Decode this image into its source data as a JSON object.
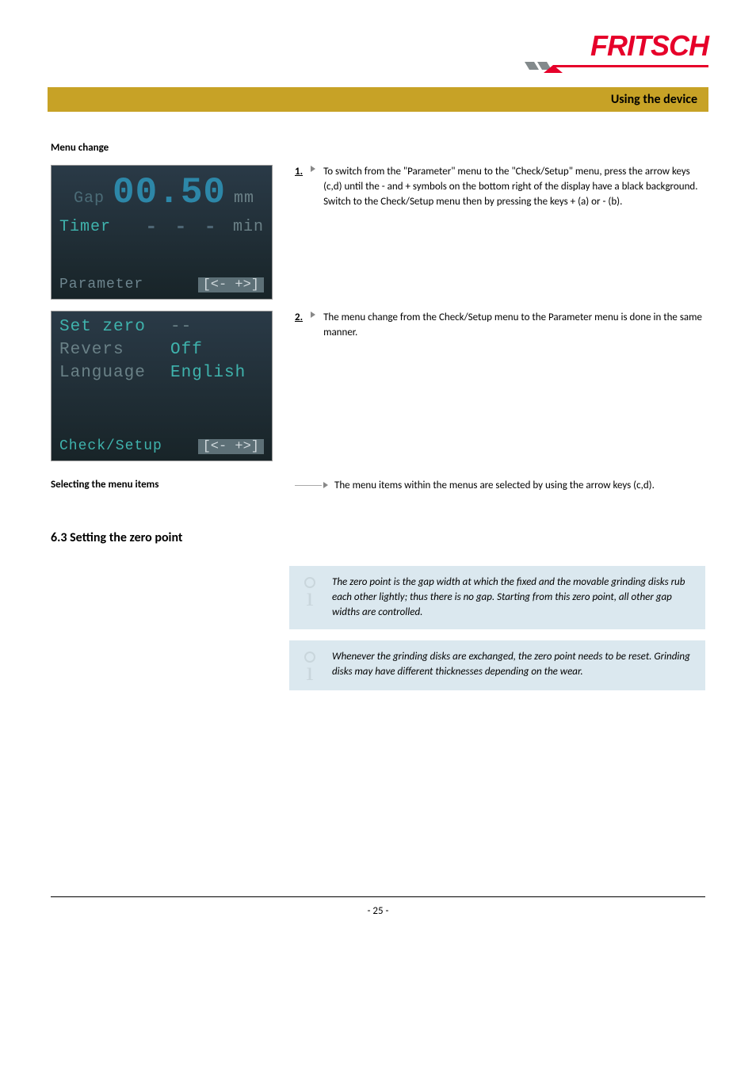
{
  "logo": {
    "text": "FRITSCH"
  },
  "title_bar": "Using the device",
  "menu_change_heading": "Menu change",
  "lcd1": {
    "gap_label": "Gap",
    "gap_value": "00.50",
    "gap_unit": "mm",
    "timer_label": "Timer",
    "timer_value": "- - -",
    "timer_unit": "min",
    "status_name": "Parameter",
    "status_arrows": "[<-  +>]"
  },
  "lcd2": {
    "setzero_label": "Set zero",
    "setzero_value": "--",
    "revers_label": "Revers",
    "revers_value": "Off",
    "language_label": "Language",
    "language_value": "English",
    "status_name": "Check/Setup",
    "status_arrows": "[<-  +>]"
  },
  "step1": {
    "num": "1.",
    "text": "To switch from the \"Parameter\" menu to the \"Check/Setup\" menu, press the arrow keys (c,d) until the - and + symbols on the bottom right of the display have a black background. Switch to the Check/Setup menu then by pressing the keys + (a) or - (b)."
  },
  "step2": {
    "num": "2.",
    "text": "The menu change from the Check/Setup menu to the Parameter menu is done in the same manner."
  },
  "selecting_label": "Selecting the menu items",
  "selecting_text": "The menu items within the menus are selected by using the arrow keys (c,d).",
  "section_heading": "6.3   Setting the zero point",
  "info1": "The zero point is the gap width at which the fixed and the movable grinding disks rub each other lightly; thus there is no gap. Starting from this zero point, all other gap widths are controlled.",
  "info2": "Whenever the grinding disks are exchanged, the zero point needs to be reset. Grinding disks may have different thick­nesses depending on the wear.",
  "footer": "- 25 -"
}
